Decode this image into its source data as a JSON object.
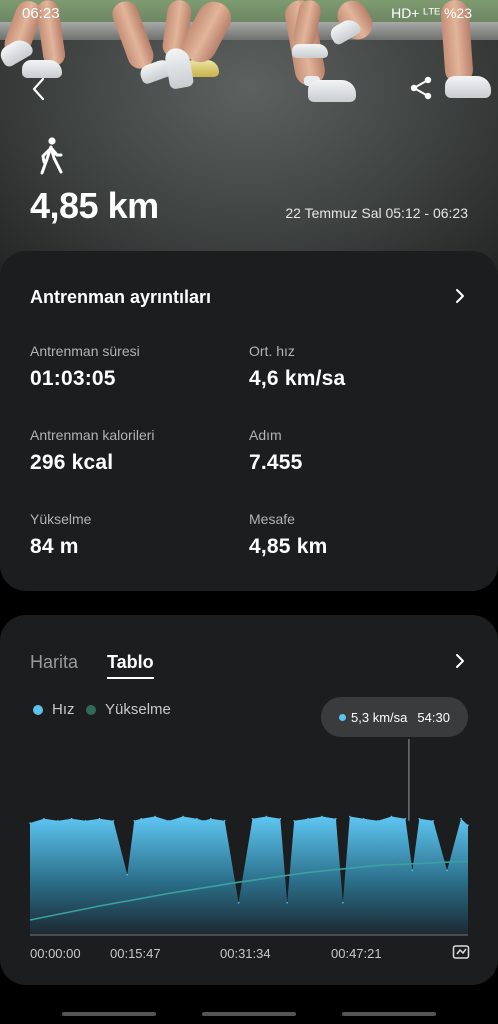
{
  "status": {
    "time": "06:23",
    "right": "HD+ ᴸᵀᴱ  %23"
  },
  "header": {
    "distance": "4,85 km",
    "date": "22 Temmuz Sal 05:12 - 06:23",
    "back_icon": "chevron-left-icon",
    "share_icon": "share-icon",
    "activity_icon": "walking-icon"
  },
  "details": {
    "title": "Antrenman ayrıntıları",
    "stats": [
      {
        "label": "Antrenman süresi",
        "value": "01:03:05"
      },
      {
        "label": "Ort. hız",
        "value": "4,6 km/sa"
      },
      {
        "label": "Antrenman kalorileri",
        "value": "296 kcal"
      },
      {
        "label": "Adım",
        "value": "7.455"
      },
      {
        "label": "Yükselme",
        "value": "84 m"
      },
      {
        "label": "Mesafe",
        "value": "4,85 km"
      }
    ]
  },
  "graph": {
    "tabs": [
      "Harita",
      "Tablo"
    ],
    "active_tab": "Tablo",
    "legend": [
      "Hız",
      "Yükselme"
    ],
    "tooltip": {
      "speed": "5,3 km/sa",
      "time": "54:30"
    },
    "colors": {
      "speed": "#5ac3ef",
      "elevation": "#2e6b57"
    }
  },
  "chart_data": {
    "type": "area",
    "x_ticks": [
      "00:00:00",
      "00:15:47",
      "00:31:34",
      "00:47:21"
    ],
    "series": [
      {
        "name": "Hız",
        "x": [
          0,
          2,
          4,
          6,
          8,
          10,
          12,
          14,
          15,
          16,
          18,
          20,
          22,
          24,
          25,
          26,
          28,
          30,
          32,
          34,
          36,
          37,
          38,
          40,
          42,
          44,
          45,
          46,
          48,
          50,
          52,
          54,
          55,
          56,
          58,
          60,
          62,
          63
        ],
        "values": [
          5.2,
          5.4,
          5.3,
          5.4,
          5.3,
          5.4,
          5.3,
          2.8,
          5.3,
          5.4,
          5.5,
          5.3,
          5.5,
          5.4,
          5.3,
          5.4,
          5.3,
          1.5,
          5.4,
          5.5,
          5.4,
          1.5,
          5.3,
          5.4,
          5.5,
          5.4,
          1.5,
          5.5,
          5.4,
          5.3,
          5.5,
          5.4,
          3.0,
          5.4,
          5.3,
          3.0,
          5.4,
          5.1
        ]
      },
      {
        "name": "Yükselme",
        "x": [
          0,
          10,
          20,
          30,
          40,
          50,
          63
        ],
        "values": [
          0,
          20,
          38,
          54,
          68,
          78,
          84
        ]
      }
    ],
    "tooltip_at": {
      "x": 54.5,
      "speed": 5.3
    }
  }
}
